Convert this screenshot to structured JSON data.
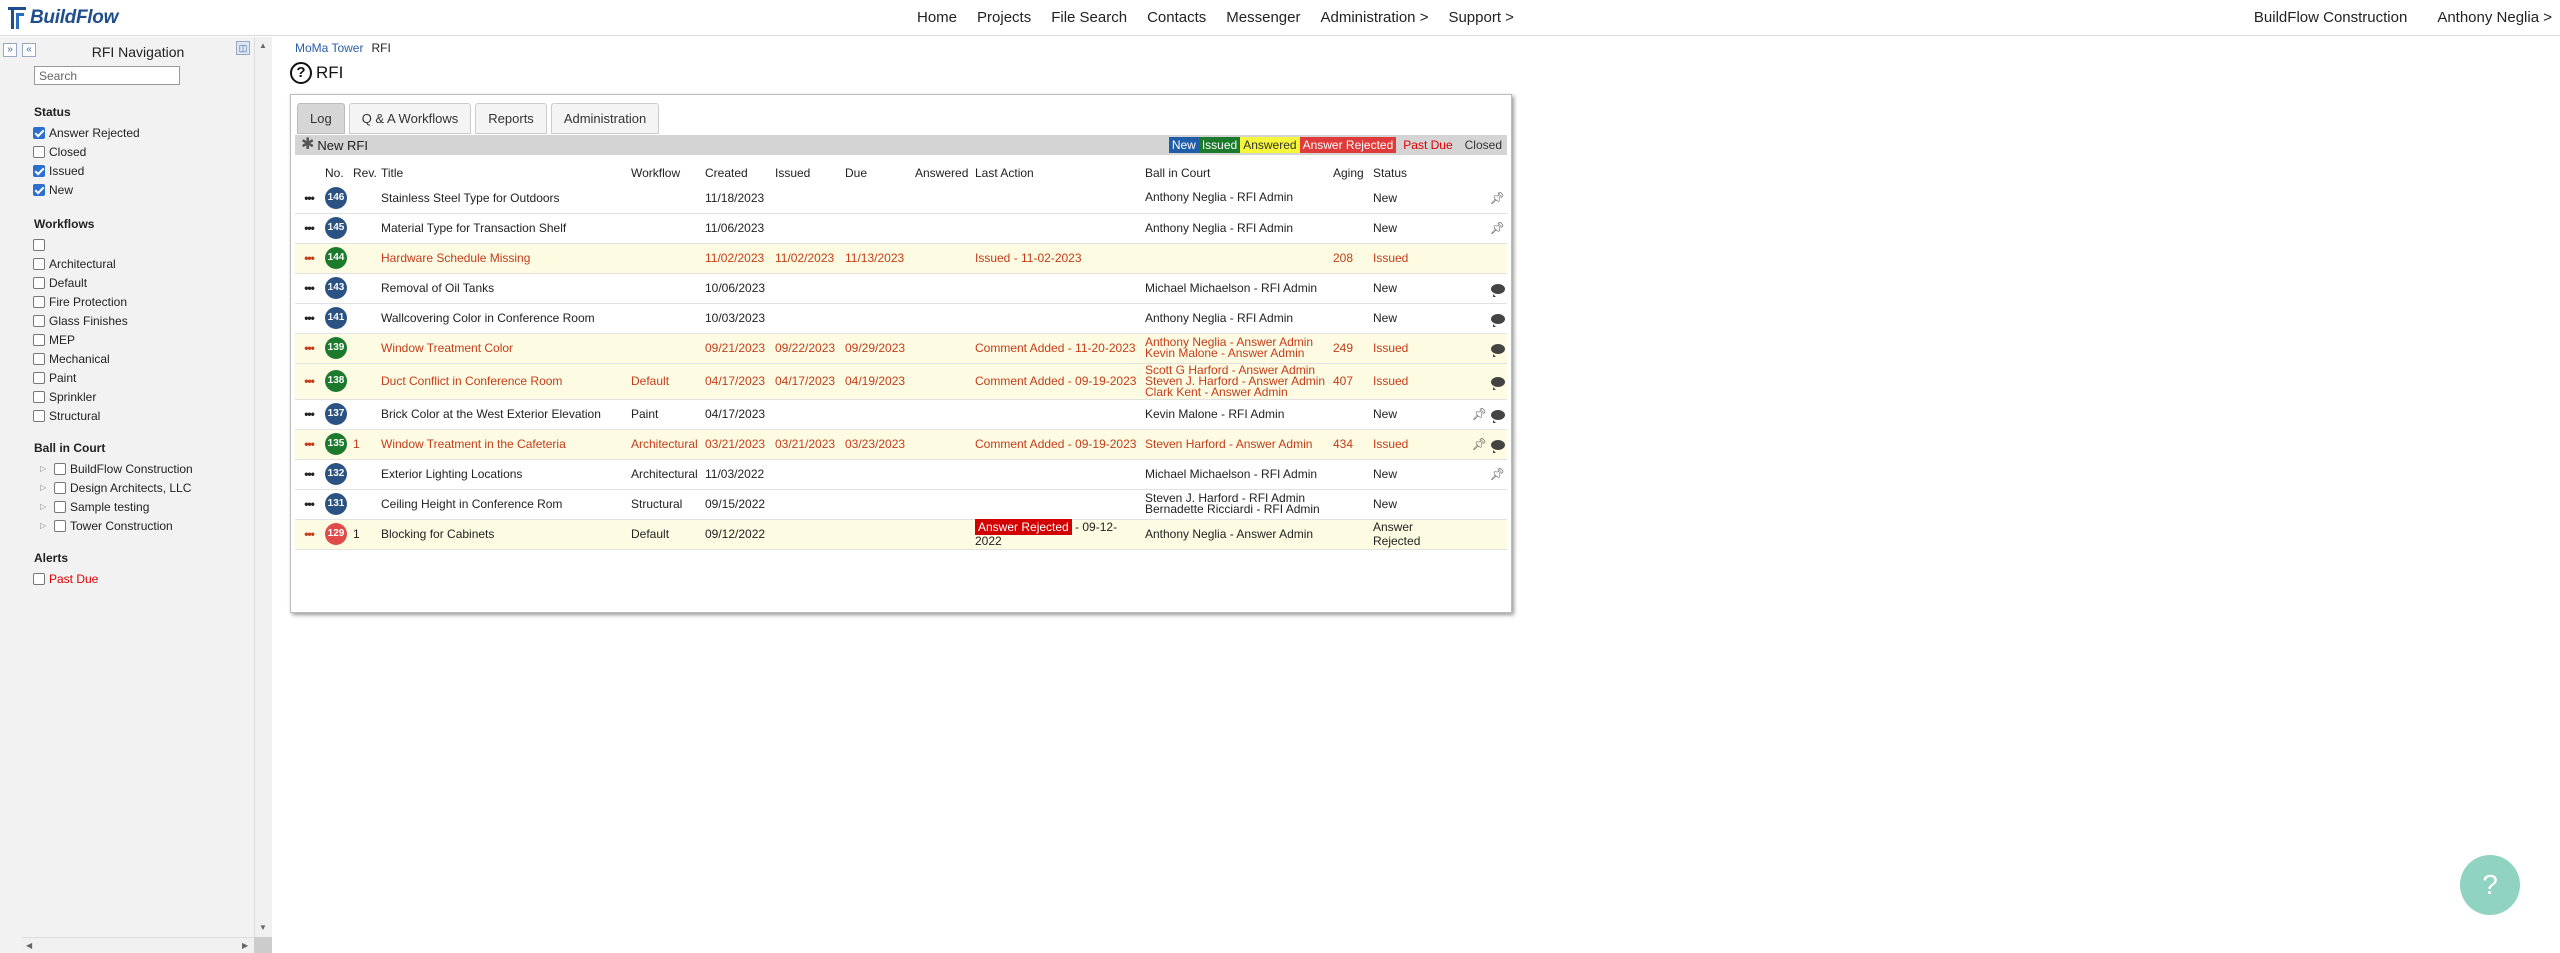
{
  "app": {
    "logo_text": "BuildFlow",
    "nav": [
      "Home",
      "Projects",
      "File Search",
      "Contacts",
      "Messenger",
      "Administration >",
      "Support >"
    ],
    "company": "BuildFlow Construction",
    "user": "Anthony Neglia >"
  },
  "leftnav": {
    "title": "RFI Navigation",
    "search_placeholder": "Search",
    "status": {
      "title": "Status",
      "items": [
        {
          "label": "Answer Rejected",
          "checked": true
        },
        {
          "label": "Closed",
          "checked": false
        },
        {
          "label": "Issued",
          "checked": true
        },
        {
          "label": "New",
          "checked": true
        }
      ]
    },
    "workflows": {
      "title": "Workflows",
      "items": [
        "",
        "Architectural",
        "Default",
        "Fire Protection",
        "Glass Finishes",
        "MEP",
        "Mechanical",
        "Paint",
        "Sprinkler",
        "Structural"
      ]
    },
    "ball_in_court": {
      "title": "Ball in Court",
      "items": [
        "BuildFlow Construction",
        "Design Architects, LLC",
        "Sample testing",
        "Tower Construction"
      ]
    },
    "alerts": {
      "title": "Alerts",
      "items": [
        {
          "label": "Past Due"
        }
      ]
    }
  },
  "breadcrumb": {
    "project": "MoMa Tower",
    "current": "RFI"
  },
  "page": {
    "title": "RFI",
    "help_glyph": "?"
  },
  "tabs": [
    "Log",
    "Q & A Workflows",
    "Reports",
    "Administration"
  ],
  "toolbar": {
    "new_rfi": "New RFI"
  },
  "legend": {
    "new": "New",
    "issued": "Issued",
    "answered": "Answered",
    "rejected": "Answer Rejected",
    "pastdue": "Past Due",
    "closed": "Closed"
  },
  "columns": [
    "No.",
    "Rev.",
    "Title",
    "Workflow",
    "Created",
    "Issued",
    "Due",
    "Answered",
    "Last Action",
    "Ball in Court",
    "Aging",
    "Status"
  ],
  "rows": [
    {
      "no": "146",
      "rev": "",
      "title": "Stainless Steel Type for Outdoors",
      "workflow": "",
      "created": "11/18/2023",
      "issued": "",
      "due": "",
      "answered": "",
      "last_action": "",
      "ball": [
        "Anthony Neglia - RFI Admin"
      ],
      "aging": "",
      "status": "New",
      "badge": "new",
      "hl": false,
      "pin": true,
      "chat": false
    },
    {
      "no": "145",
      "rev": "",
      "title": "Material Type for Transaction Shelf",
      "workflow": "",
      "created": "11/06/2023",
      "issued": "",
      "due": "",
      "answered": "",
      "last_action": "",
      "ball": [
        "Anthony Neglia - RFI Admin"
      ],
      "aging": "",
      "status": "New",
      "badge": "new",
      "hl": false,
      "pin": true,
      "chat": false
    },
    {
      "no": "144",
      "rev": "",
      "title": "Hardware Schedule Missing",
      "workflow": "",
      "created": "11/02/2023",
      "issued": "11/02/2023",
      "due": "11/13/2023",
      "answered": "",
      "last_action": "Issued - 11-02-2023",
      "ball": [],
      "aging": "208",
      "status": "Issued",
      "badge": "issued",
      "hl": true,
      "pin": false,
      "chat": false
    },
    {
      "no": "143",
      "rev": "",
      "title": "Removal of Oil Tanks",
      "workflow": "",
      "created": "10/06/2023",
      "issued": "",
      "due": "",
      "answered": "",
      "last_action": "",
      "ball": [
        "Michael Michaelson - RFI Admin"
      ],
      "aging": "",
      "status": "New",
      "badge": "new",
      "hl": false,
      "pin": false,
      "chat": true
    },
    {
      "no": "141",
      "rev": "",
      "title": "Wallcovering Color in Conference Room",
      "workflow": "",
      "created": "10/03/2023",
      "issued": "",
      "due": "",
      "answered": "",
      "last_action": "",
      "ball": [
        "Anthony Neglia - RFI Admin"
      ],
      "aging": "",
      "status": "New",
      "badge": "new",
      "hl": false,
      "pin": false,
      "chat": true
    },
    {
      "no": "139",
      "rev": "",
      "title": "Window Treatment Color",
      "workflow": "",
      "created": "09/21/2023",
      "issued": "09/22/2023",
      "due": "09/29/2023",
      "answered": "",
      "last_action": "Comment Added - 11-20-2023",
      "ball": [
        "Anthony Neglia - Answer Admin",
        "Kevin Malone - Answer Admin"
      ],
      "aging": "249",
      "status": "Issued",
      "badge": "issued",
      "hl": true,
      "pin": false,
      "chat": true
    },
    {
      "no": "138",
      "rev": "",
      "title": "Duct Conflict in Conference Room",
      "workflow": "Default",
      "created": "04/17/2023",
      "issued": "04/17/2023",
      "due": "04/19/2023",
      "answered": "",
      "last_action": "Comment Added - 09-19-2023",
      "ball": [
        "Scott G Harford - Answer Admin",
        "Steven J. Harford - Answer Admin",
        "Clark Kent - Answer Admin"
      ],
      "aging": "407",
      "status": "Issued",
      "badge": "issued",
      "hl": true,
      "pin": false,
      "chat": true
    },
    {
      "no": "137",
      "rev": "",
      "title": "Brick Color at the West Exterior Elevation",
      "workflow": "Paint",
      "created": "04/17/2023",
      "issued": "",
      "due": "",
      "answered": "",
      "last_action": "",
      "ball": [
        "Kevin Malone - RFI Admin"
      ],
      "aging": "",
      "status": "New",
      "badge": "new",
      "hl": false,
      "pin": true,
      "chat": true
    },
    {
      "no": "135",
      "rev": "1",
      "title": "Window Treatment in the Cafeteria",
      "workflow": "Architectural",
      "created": "03/21/2023",
      "issued": "03/21/2023",
      "due": "03/23/2023",
      "answered": "",
      "last_action": "Comment Added - 09-19-2023",
      "ball": [
        "Steven Harford - Answer Admin"
      ],
      "aging": "434",
      "status": "Issued",
      "badge": "issued",
      "hl": true,
      "pin": true,
      "chat": true
    },
    {
      "no": "132",
      "rev": "",
      "title": "Exterior Lighting Locations",
      "workflow": "Architectural",
      "created": "11/03/2022",
      "issued": "",
      "due": "",
      "answered": "",
      "last_action": "",
      "ball": [
        "Michael Michaelson - RFI Admin"
      ],
      "aging": "",
      "status": "New",
      "badge": "new",
      "hl": false,
      "pin": true,
      "chat": false
    },
    {
      "no": "131",
      "rev": "",
      "title": "Ceiling Height in Conference Rom",
      "workflow": "Structural",
      "created": "09/15/2022",
      "issued": "",
      "due": "",
      "answered": "",
      "last_action": "",
      "ball": [
        "Steven J. Harford - RFI Admin",
        "Bernadette Ricciardi - RFI Admin"
      ],
      "aging": "",
      "status": "New",
      "badge": "new",
      "hl": false,
      "pin": false,
      "chat": false
    },
    {
      "no": "129",
      "rev": "1",
      "title": "Blocking for Cabinets",
      "workflow": "Default",
      "created": "09/12/2022",
      "issued": "",
      "due": "",
      "answered": "",
      "last_action": "Answer Rejected",
      "last_action_suffix": " - 09-12-2022",
      "ball": [
        "Anthony Neglia - Answer Admin"
      ],
      "aging": "",
      "status": "Answer Rejected",
      "badge": "rejected",
      "hl": true,
      "pin": false,
      "chat": false,
      "plain_text": true
    }
  ],
  "help_fab": "?"
}
